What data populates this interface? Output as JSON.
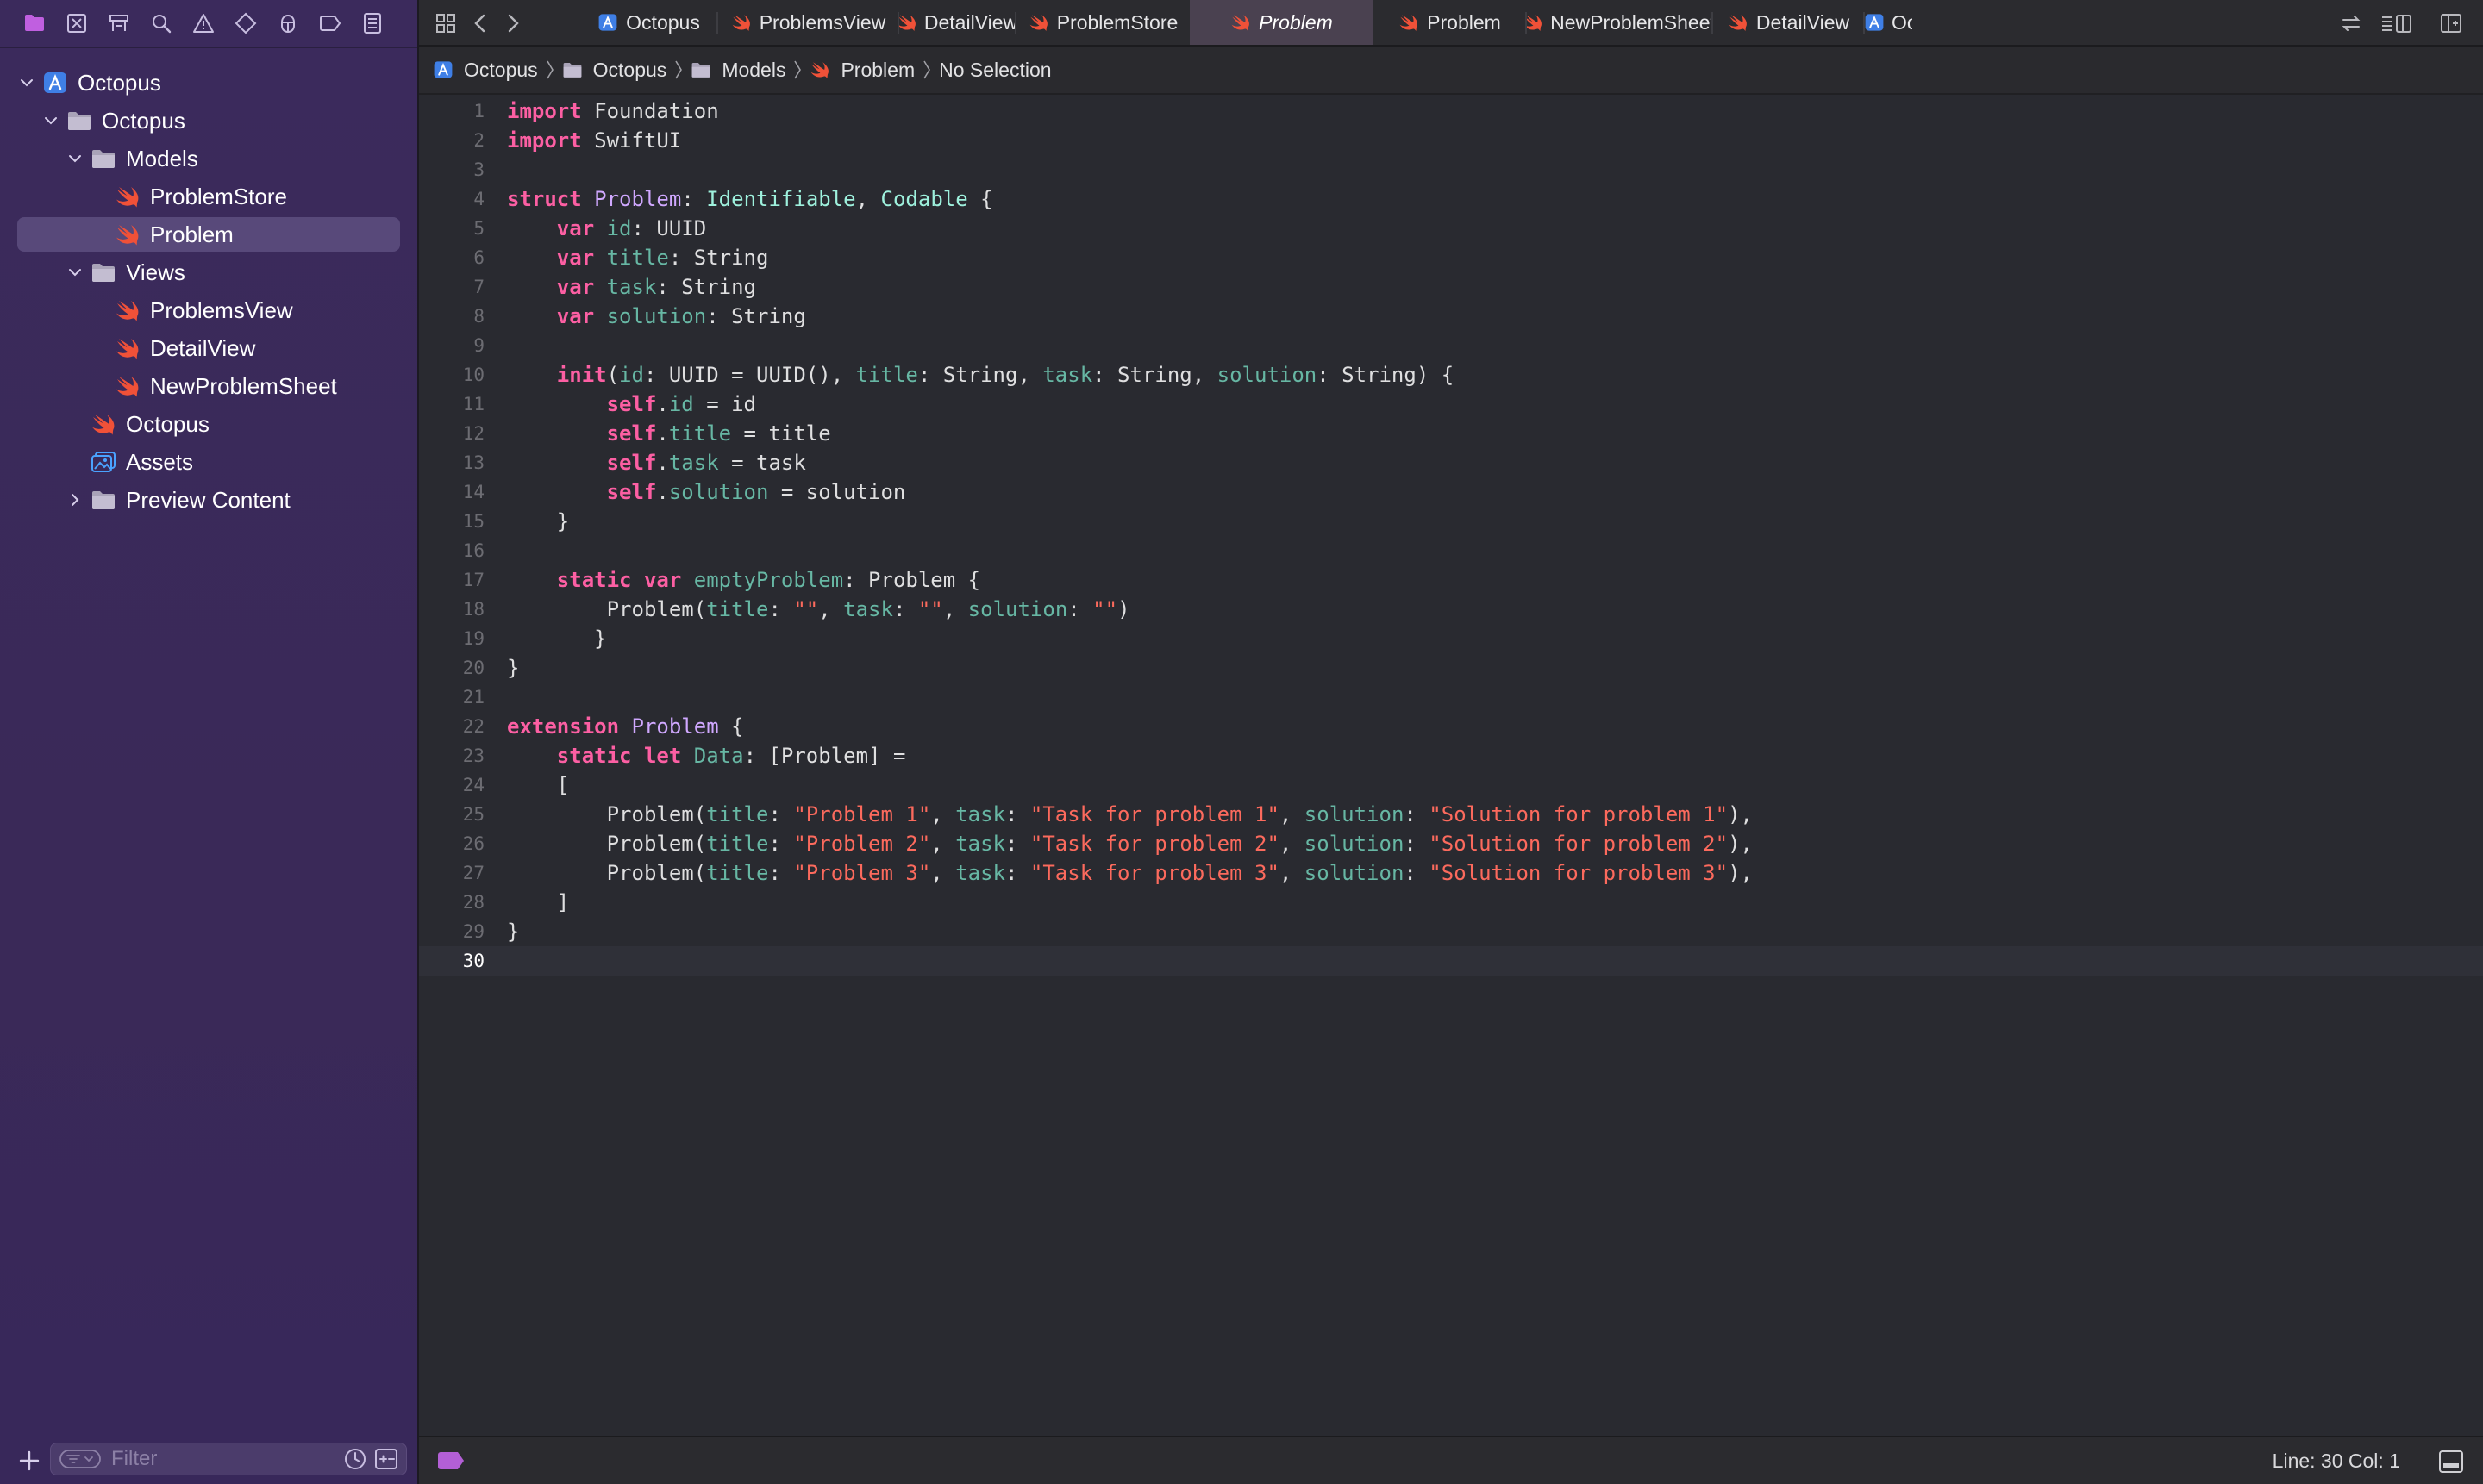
{
  "navigator": {
    "toolbar_icons": [
      "folder-icon",
      "source-control-icon",
      "symbol-icon",
      "find-icon",
      "issue-icon",
      "test-icon",
      "debug-icon",
      "breakpoint-icon",
      "report-icon"
    ],
    "tree": [
      {
        "label": "Octopus",
        "icon": "xcode-project-icon",
        "depth": 0,
        "chevron": "down"
      },
      {
        "label": "Octopus",
        "icon": "folder-icon",
        "depth": 1,
        "chevron": "down"
      },
      {
        "label": "Models",
        "icon": "folder-icon",
        "depth": 2,
        "chevron": "down"
      },
      {
        "label": "ProblemStore",
        "icon": "swift-file-icon",
        "depth": 3,
        "chevron": ""
      },
      {
        "label": "Problem",
        "icon": "swift-file-icon",
        "depth": 3,
        "chevron": "",
        "selected": true
      },
      {
        "label": "Views",
        "icon": "folder-icon",
        "depth": 2,
        "chevron": "down"
      },
      {
        "label": "ProblemsView",
        "icon": "swift-file-icon",
        "depth": 3,
        "chevron": ""
      },
      {
        "label": "DetailView",
        "icon": "swift-file-icon",
        "depth": 3,
        "chevron": ""
      },
      {
        "label": "NewProblemSheet",
        "icon": "swift-file-icon",
        "depth": 3,
        "chevron": ""
      },
      {
        "label": "Octopus",
        "icon": "swift-file-icon",
        "depth": 2,
        "chevron": ""
      },
      {
        "label": "Assets",
        "icon": "assets-icon",
        "depth": 2,
        "chevron": ""
      },
      {
        "label": "Preview Content",
        "icon": "folder-icon",
        "depth": 2,
        "chevron": "right"
      }
    ],
    "filter_placeholder": "Filter"
  },
  "tabs": [
    {
      "label": "Octopus",
      "icon": "xcode-project-icon"
    },
    {
      "label": "ProblemsView",
      "icon": "swift-file-icon"
    },
    {
      "label": "DetailView",
      "icon": "swift-file-icon"
    },
    {
      "label": "ProblemStore",
      "icon": "swift-file-icon"
    },
    {
      "label": "Problem",
      "icon": "swift-file-icon",
      "active": true
    },
    {
      "label": "Problem",
      "icon": "swift-file-icon"
    },
    {
      "label": "NewProblemSheet",
      "icon": "swift-file-icon"
    },
    {
      "label": "DetailView",
      "icon": "swift-file-icon"
    },
    {
      "label": "Oc",
      "icon": "xcode-project-icon"
    }
  ],
  "breadcrumb": [
    {
      "label": "Octopus",
      "icon": "xcode-project-icon"
    },
    {
      "label": "Octopus",
      "icon": "folder-icon"
    },
    {
      "label": "Models",
      "icon": "folder-icon"
    },
    {
      "label": "Problem",
      "icon": "swift-file-icon"
    },
    {
      "label": "No Selection",
      "icon": ""
    }
  ],
  "editor": {
    "current_line": 30,
    "lines": [
      [
        [
          "kw",
          "import"
        ],
        [
          "pl",
          " Foundation"
        ]
      ],
      [
        [
          "kw",
          "import"
        ],
        [
          "pl",
          " SwiftUI"
        ]
      ],
      [],
      [
        [
          "kw",
          "struct"
        ],
        [
          "pl",
          " "
        ],
        [
          "ty",
          "Problem"
        ],
        [
          "pl",
          ": "
        ],
        [
          "tp",
          "Identifiable"
        ],
        [
          "pl",
          ", "
        ],
        [
          "tp",
          "Codable"
        ],
        [
          "pl",
          " {"
        ]
      ],
      [
        [
          "pl",
          "    "
        ],
        [
          "kw",
          "var"
        ],
        [
          "pl",
          " "
        ],
        [
          "pr",
          "id"
        ],
        [
          "pl",
          ": UUID"
        ]
      ],
      [
        [
          "pl",
          "    "
        ],
        [
          "kw",
          "var"
        ],
        [
          "pl",
          " "
        ],
        [
          "pr",
          "title"
        ],
        [
          "pl",
          ": String"
        ]
      ],
      [
        [
          "pl",
          "    "
        ],
        [
          "kw",
          "var"
        ],
        [
          "pl",
          " "
        ],
        [
          "pr",
          "task"
        ],
        [
          "pl",
          ": String"
        ]
      ],
      [
        [
          "pl",
          "    "
        ],
        [
          "kw",
          "var"
        ],
        [
          "pl",
          " "
        ],
        [
          "pr",
          "solution"
        ],
        [
          "pl",
          ": String"
        ]
      ],
      [],
      [
        [
          "pl",
          "    "
        ],
        [
          "kw",
          "init"
        ],
        [
          "pl",
          "("
        ],
        [
          "pr",
          "id"
        ],
        [
          "pl",
          ": UUID = UUID(), "
        ],
        [
          "pr",
          "title"
        ],
        [
          "pl",
          ": String, "
        ],
        [
          "pr",
          "task"
        ],
        [
          "pl",
          ": String, "
        ],
        [
          "pr",
          "solution"
        ],
        [
          "pl",
          ": String) {"
        ]
      ],
      [
        [
          "pl",
          "        "
        ],
        [
          "kw",
          "self"
        ],
        [
          "pl",
          "."
        ],
        [
          "pr",
          "id"
        ],
        [
          "pl",
          " = id"
        ]
      ],
      [
        [
          "pl",
          "        "
        ],
        [
          "kw",
          "self"
        ],
        [
          "pl",
          "."
        ],
        [
          "pr",
          "title"
        ],
        [
          "pl",
          " = title"
        ]
      ],
      [
        [
          "pl",
          "        "
        ],
        [
          "kw",
          "self"
        ],
        [
          "pl",
          "."
        ],
        [
          "pr",
          "task"
        ],
        [
          "pl",
          " = task"
        ]
      ],
      [
        [
          "pl",
          "        "
        ],
        [
          "kw",
          "self"
        ],
        [
          "pl",
          "."
        ],
        [
          "pr",
          "solution"
        ],
        [
          "pl",
          " = solution"
        ]
      ],
      [
        [
          "pl",
          "    }"
        ]
      ],
      [],
      [
        [
          "pl",
          "    "
        ],
        [
          "kw",
          "static"
        ],
        [
          "pl",
          " "
        ],
        [
          "kw",
          "var"
        ],
        [
          "pl",
          " "
        ],
        [
          "pr",
          "emptyProblem"
        ],
        [
          "pl",
          ": Problem {"
        ]
      ],
      [
        [
          "pl",
          "        Problem("
        ],
        [
          "pr",
          "title"
        ],
        [
          "pl",
          ": "
        ],
        [
          "st",
          "\"\""
        ],
        [
          "pl",
          ", "
        ],
        [
          "pr",
          "task"
        ],
        [
          "pl",
          ": "
        ],
        [
          "st",
          "\"\""
        ],
        [
          "pl",
          ", "
        ],
        [
          "pr",
          "solution"
        ],
        [
          "pl",
          ": "
        ],
        [
          "st",
          "\"\""
        ],
        [
          "pl",
          ")"
        ]
      ],
      [
        [
          "pl",
          "       }"
        ]
      ],
      [
        [
          "pl",
          "}"
        ]
      ],
      [],
      [
        [
          "kw",
          "extension"
        ],
        [
          "pl",
          " "
        ],
        [
          "ty",
          "Problem"
        ],
        [
          "pl",
          " {"
        ]
      ],
      [
        [
          "pl",
          "    "
        ],
        [
          "kw",
          "static"
        ],
        [
          "pl",
          " "
        ],
        [
          "kw",
          "let"
        ],
        [
          "pl",
          " "
        ],
        [
          "pr",
          "Data"
        ],
        [
          "pl",
          ": [Problem] ="
        ]
      ],
      [
        [
          "pl",
          "    ["
        ]
      ],
      [
        [
          "pl",
          "        Problem("
        ],
        [
          "pr",
          "title"
        ],
        [
          "pl",
          ": "
        ],
        [
          "st",
          "\"Problem 1\""
        ],
        [
          "pl",
          ", "
        ],
        [
          "pr",
          "task"
        ],
        [
          "pl",
          ": "
        ],
        [
          "st",
          "\"Task for problem 1\""
        ],
        [
          "pl",
          ", "
        ],
        [
          "pr",
          "solution"
        ],
        [
          "pl",
          ": "
        ],
        [
          "st",
          "\"Solution for problem 1\""
        ],
        [
          "pl",
          "),"
        ]
      ],
      [
        [
          "pl",
          "        Problem("
        ],
        [
          "pr",
          "title"
        ],
        [
          "pl",
          ": "
        ],
        [
          "st",
          "\"Problem 2\""
        ],
        [
          "pl",
          ", "
        ],
        [
          "pr",
          "task"
        ],
        [
          "pl",
          ": "
        ],
        [
          "st",
          "\"Task for problem 2\""
        ],
        [
          "pl",
          ", "
        ],
        [
          "pr",
          "solution"
        ],
        [
          "pl",
          ": "
        ],
        [
          "st",
          "\"Solution for problem 2\""
        ],
        [
          "pl",
          "),"
        ]
      ],
      [
        [
          "pl",
          "        Problem("
        ],
        [
          "pr",
          "title"
        ],
        [
          "pl",
          ": "
        ],
        [
          "st",
          "\"Problem 3\""
        ],
        [
          "pl",
          ", "
        ],
        [
          "pr",
          "task"
        ],
        [
          "pl",
          ": "
        ],
        [
          "st",
          "\"Task for problem 3\""
        ],
        [
          "pl",
          ", "
        ],
        [
          "pr",
          "solution"
        ],
        [
          "pl",
          ": "
        ],
        [
          "st",
          "\"Solution for problem 3\""
        ],
        [
          "pl",
          "),"
        ]
      ],
      [
        [
          "pl",
          "    ]"
        ]
      ],
      [
        [
          "pl",
          "}"
        ]
      ],
      []
    ]
  },
  "status": {
    "line_col": "Line: 30  Col: 1"
  },
  "colors": {
    "sidebar_bg": "#3a2958",
    "selection_bg": "#58497a",
    "editor_bg": "#292a30",
    "keyword": "#fc5fa3",
    "string": "#fc6a5d",
    "swift_orange": "#f05138",
    "project_blue": "#3f7fe6"
  }
}
